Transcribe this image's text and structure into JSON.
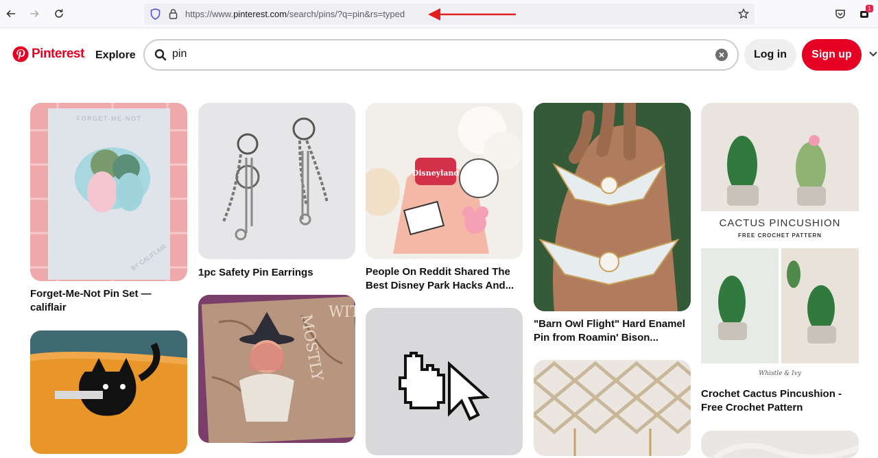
{
  "browser": {
    "url_prefix": "https://www.",
    "url_domain": "pinterest.com",
    "url_path": "/search/pins/?q=pin&rs=typed",
    "notification_count": "1"
  },
  "header": {
    "logo_text": "Pinterest",
    "explore_label": "Explore",
    "search_value": "pin",
    "login_label": "Log in",
    "signup_label": "Sign up"
  },
  "colors": {
    "brand": "#e60023",
    "annotation_arrow": "#e02020"
  },
  "pins": [
    {
      "title": "Forget-Me-Not Pin Set — califlair",
      "image_text": [
        "FORGET-ME-NOT",
        "BY CALIFLAIR"
      ]
    },
    {
      "title": "",
      "image_text": []
    },
    {
      "title": "1pc Safety Pin Earrings",
      "image_text": []
    },
    {
      "title": "",
      "image_text": [
        "MOSTLY",
        "WITCH"
      ]
    },
    {
      "title": "People On Reddit Shared The Best Disney Park Hacks And...",
      "image_text": [
        "Disneyland"
      ]
    },
    {
      "title": "",
      "image_text": []
    },
    {
      "title": "\"Barn Owl Flight\" Hard Enamel Pin from Roamin' Bison...",
      "image_text": []
    },
    {
      "title": "",
      "image_text": []
    },
    {
      "title": "Crochet Cactus Pincushion - Free Crochet Pattern",
      "image_text": [
        "CACTUS PINCUSHION",
        "FREE CROCHET PATTERN",
        "Whistle & Ivy"
      ]
    },
    {
      "title": "",
      "image_text": []
    }
  ]
}
